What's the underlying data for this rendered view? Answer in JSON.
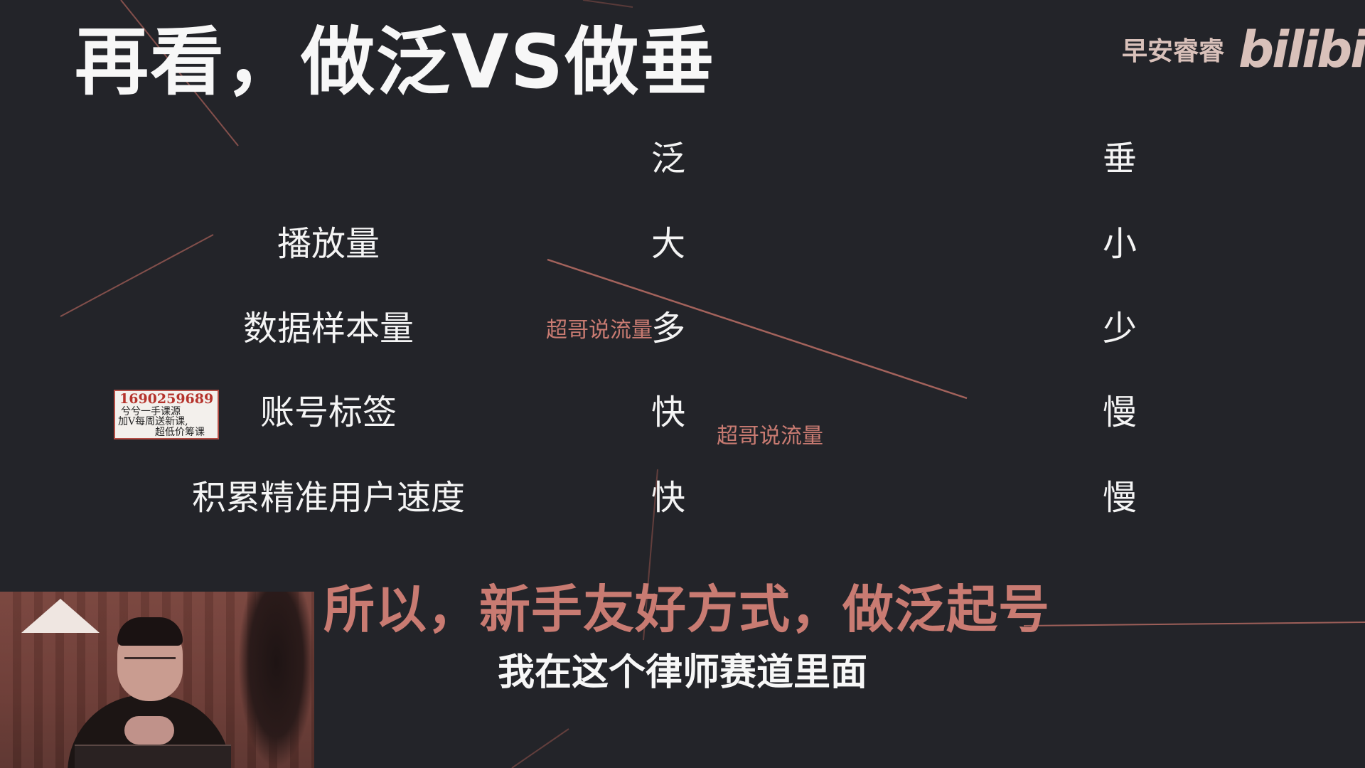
{
  "slide": {
    "title": "再看，做泛VS做垂",
    "brand": "早安睿睿",
    "logo": "bilibili",
    "columns": {
      "col_a": "泛",
      "col_b": "垂"
    },
    "rows": [
      {
        "label": "播放量",
        "a": "大",
        "b": "小"
      },
      {
        "label": "数据样本量",
        "a": "多",
        "b": "少"
      },
      {
        "label": "账号标签",
        "a": "快",
        "b": "慢"
      },
      {
        "label": "积累精准用户速度",
        "a": "快",
        "b": "慢"
      }
    ],
    "conclusion": "所以，新手友好方式，做泛起号"
  },
  "overlay": {
    "watermark_1": "超哥说流量",
    "watermark_2": "超哥说流量",
    "stamp": {
      "number": "1690259689",
      "line2": "兮兮一手课源",
      "line3": "加V每周送新课,",
      "line4": "超低价筹课"
    }
  },
  "subtitle": "我在这个律师赛道里面",
  "colors": {
    "background": "#232429",
    "accent": "#c97b72",
    "text": "#f4f4f4"
  }
}
